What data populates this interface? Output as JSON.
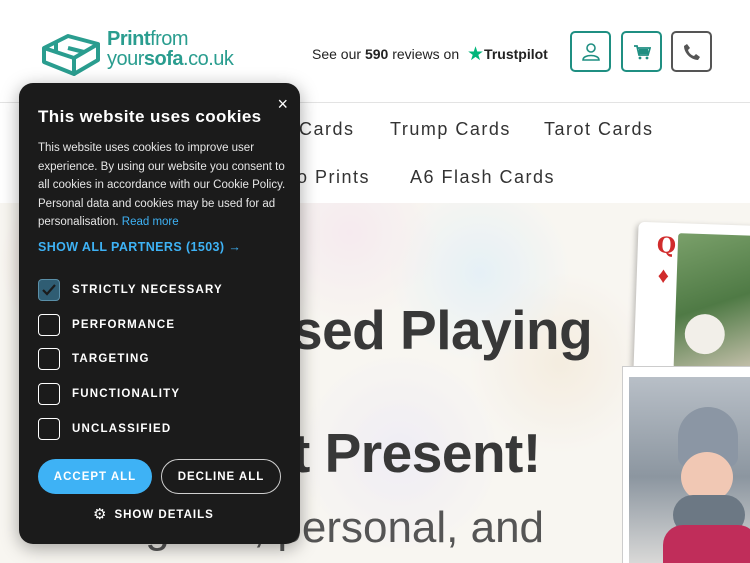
{
  "header": {
    "logo": {
      "line1_a": "Print",
      "line1_b": "from",
      "line2_a": "your",
      "line2_b": "sofa",
      "line2_c": ".co.uk"
    },
    "trustpilot": {
      "prefix": "See our",
      "count": "590",
      "suffix": "reviews on",
      "brand": "Trustpilot",
      "star_color": "#00b67a"
    },
    "icons": {
      "account": "user-icon",
      "cart": "cart-icon",
      "phone": "phone-icon"
    }
  },
  "nav": {
    "row1": [
      "Cards",
      "Trump Cards",
      "Tarot Cards"
    ],
    "row2": [
      "o Prints",
      "A6 Flash Cards"
    ]
  },
  "hero": {
    "title_line1": "sed Playing",
    "title_line2": "t Present!",
    "subtitle": "Thoughtful, personal, and",
    "card_rank": "Q",
    "card_suit": "♦"
  },
  "cookie": {
    "title": "This website uses cookies",
    "close_label": "×",
    "body": "This website uses cookies to improve user experience. By using our website you consent to all cookies in accordance with our Cookie Policy. Personal data and cookies may be used for ad personalisation.",
    "read_more": "Read more",
    "partners": "SHOW ALL PARTNERS (1503) →",
    "options": [
      {
        "label": "STRICTLY NECESSARY",
        "checked": true
      },
      {
        "label": "PERFORMANCE",
        "checked": false
      },
      {
        "label": "TARGETING",
        "checked": false
      },
      {
        "label": "FUNCTIONALITY",
        "checked": false
      },
      {
        "label": "UNCLASSIFIED",
        "checked": false
      }
    ],
    "accept": "ACCEPT ALL",
    "decline": "DECLINE ALL",
    "details": "SHOW DETAILS"
  },
  "colors": {
    "brand": "#2a9d8f",
    "cookie_bg": "#1b1b1b",
    "cookie_accent": "#3eb2f5"
  }
}
